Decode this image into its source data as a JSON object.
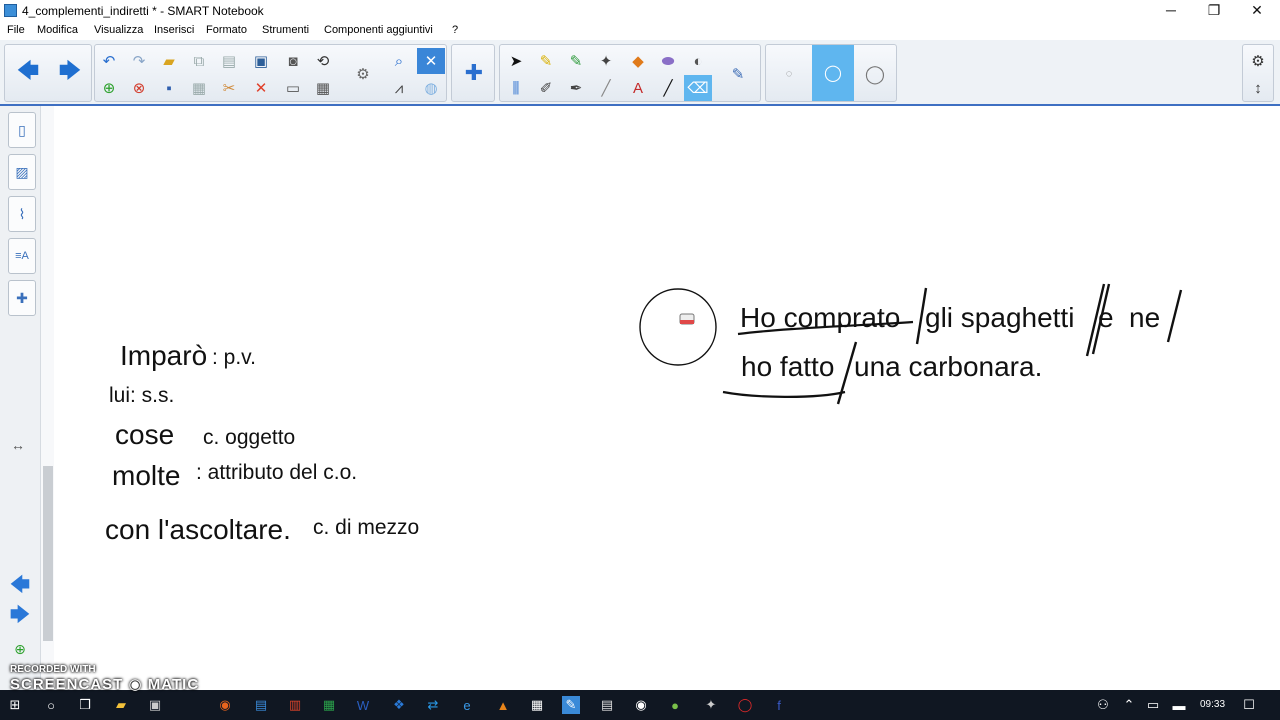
{
  "window": {
    "title": "4_complementi_indiretti * - SMART Notebook",
    "minimize": "─",
    "maximize": "❐",
    "close": "✕"
  },
  "menu": [
    "File",
    "Modifica",
    "Visualizza",
    "Inserisci",
    "Formato",
    "Strumenti",
    "Componenti aggiuntivi",
    "?"
  ],
  "canvas": {
    "left_analysis": {
      "line1_word": "Imparò",
      "line1_label": ": p.v.",
      "line2": "lui: s.s.",
      "line3_word": "cose",
      "line3_label": "c. oggetto",
      "line4_word": "molte",
      "line4_label": ": attributo del c.o.",
      "line5_word": "con l'ascoltare.",
      "line5_label": "c. di mezzo"
    },
    "sentence": {
      "p1": "Ho comprato",
      "p2": "gli spaghetti",
      "p3": "e",
      "p4": "ne",
      "p5": "ho fatto",
      "p6": "una carbonara."
    }
  },
  "taskbar": {
    "clock": "09:33"
  },
  "watermark": {
    "line1": "RECORDED WITH",
    "line2": "SCREENCAST ◉ MATIC"
  },
  "colors": {
    "accent": "#3e6fc2",
    "active": "#5fb6ef",
    "taskbar": "#101722"
  }
}
